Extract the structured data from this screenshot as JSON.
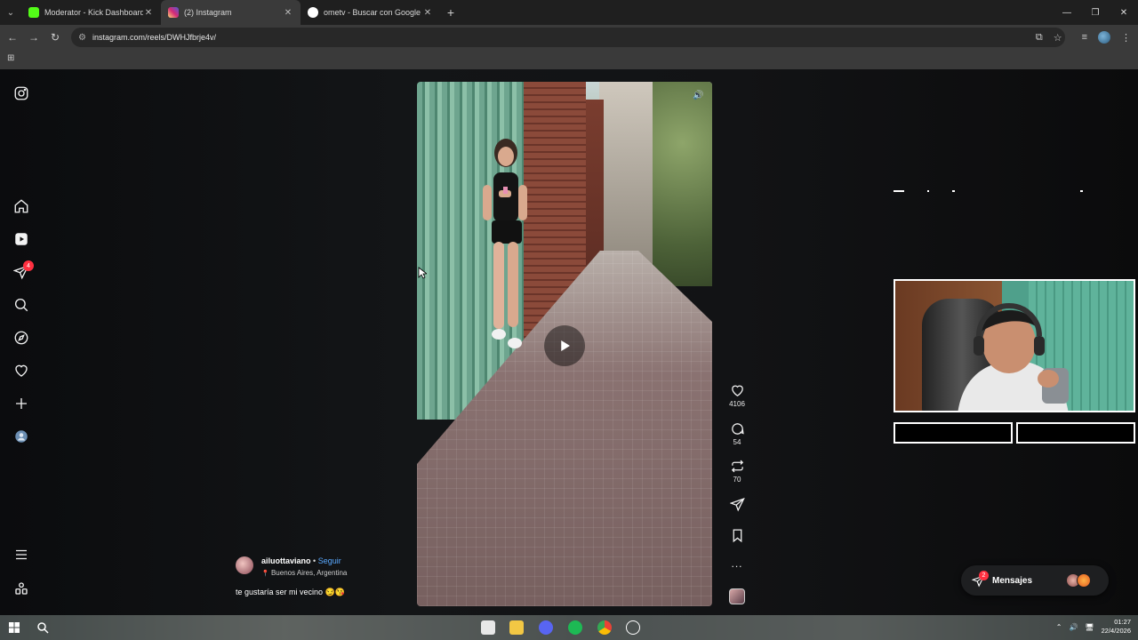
{
  "browser": {
    "tabs": [
      {
        "title": "Moderator - Kick Dashboard",
        "favicon_color": "#53fc18",
        "active": false
      },
      {
        "title": "(2) Instagram",
        "favicon_color": "#d6249f",
        "active": true
      },
      {
        "title": "ometv - Buscar con Google",
        "favicon_color": "#4285f4",
        "active": false
      }
    ],
    "new_tab": "+",
    "url": "instagram.com/reels/DWHJfbrje4v/",
    "window_controls": {
      "minimize": "—",
      "maximize": "❐",
      "close": "✕"
    }
  },
  "sidebar": {
    "items": [
      {
        "name": "instagram-logo-icon",
        "label": "Instagram"
      },
      {
        "name": "home-icon",
        "label": "Inicio"
      },
      {
        "name": "reels-icon",
        "label": "Reels"
      },
      {
        "name": "messages-icon",
        "label": "Mensajes"
      },
      {
        "name": "search-icon",
        "label": "Buscar"
      },
      {
        "name": "explore-icon",
        "label": "Explorar"
      },
      {
        "name": "notifications-icon",
        "label": "Notificaciones"
      },
      {
        "name": "create-icon",
        "label": "Crear"
      },
      {
        "name": "profile-icon",
        "label": "Perfil"
      },
      {
        "name": "menu-icon",
        "label": "Más"
      },
      {
        "name": "threads-icon",
        "label": "Threads"
      }
    ],
    "messages_badge": "4"
  },
  "reel": {
    "actions": {
      "likes": "4106",
      "comments": "54",
      "reposts": "70"
    },
    "more": "...",
    "caption": {
      "username": "ailuottaviano",
      "separator": "•",
      "follow": "Seguir",
      "location": "Buenos Aires, Argentina",
      "text": "te gustaría ser mi vecino 😏😘"
    }
  },
  "messages_bar": {
    "label": "Mensajes",
    "badge": "2"
  },
  "taskbar": {
    "time": "01:27",
    "date": "22/4/2026"
  },
  "colors": {
    "instagram_blue": "#5aa9ff",
    "badge_red": "#ff3040"
  }
}
